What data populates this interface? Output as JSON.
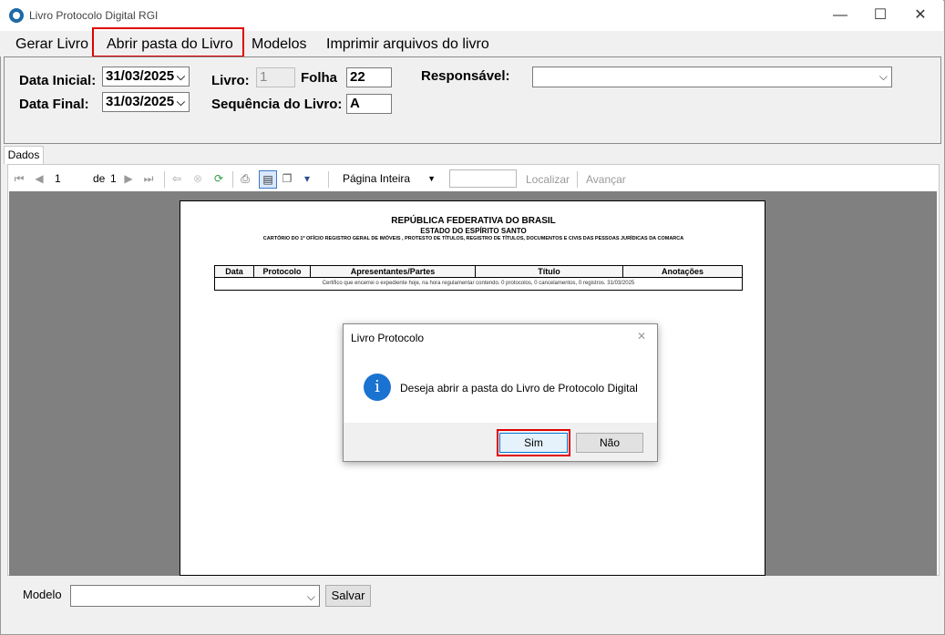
{
  "window": {
    "title": "Livro Protocolo Digital RGI",
    "minimize": "—",
    "maximize": "☐",
    "close": "✕"
  },
  "menu": {
    "items": [
      "Gerar Livro",
      "Abrir pasta do Livro",
      "Modelos",
      "Imprimir arquivos do livro"
    ]
  },
  "filters": {
    "data_inicial_label": "Data Inicial:",
    "data_inicial_value": "31/03/2025",
    "data_final_label": "Data Final:",
    "data_final_value": "31/03/2025",
    "livro_label": "Livro:",
    "livro_value": "1",
    "folha_label": "Folha",
    "folha_value": "22",
    "sequencia_label": "Sequência do Livro:",
    "sequencia_value": "A",
    "responsavel_label": "Responsável:",
    "responsavel_value": ""
  },
  "tabs": {
    "dados": "Dados"
  },
  "report_toolbar": {
    "page_value": "1",
    "of_label": "de",
    "total_pages": "1",
    "zoom_option": "Página Inteira",
    "search_value": "",
    "find_label": "Localizar",
    "next_label": "Avançar"
  },
  "report": {
    "title": "REPÚBLICA FEDERATIVA DO BRASIL",
    "state": "ESTADO DO ESPÍRITO SANTO",
    "office": "CARTÓRIO DO 1º OFÍCIO REGISTRO GERAL DE IMÓVEIS , PROTESTO DE TÍTULOS, REGISTRO DE TÍTULOS, DOCUMENTOS E CIVIS DAS PESSOAS JURÍDICAS DA COMARCA",
    "columns": [
      "Data",
      "Protocolo",
      "Apresentantes/Partes",
      "Título",
      "Anotações"
    ],
    "certification": "Certifico que encerrei o expediente hoje, na hora regulamentar contendo. 0 protocolos, 0 cancelamentos, 0 registros. 31/03/2025"
  },
  "dialog": {
    "title": "Livro Protocolo",
    "message": "Deseja abrir a pasta do Livro de Protocolo Digital",
    "yes_label": "Sim",
    "no_label": "Não",
    "close": "✕",
    "info_glyph": "i"
  },
  "bottom": {
    "modelo_label": "Modelo",
    "modelo_value": "",
    "save_label": "Salvar"
  },
  "colors": {
    "highlight": "#e00000",
    "info_icon": "#1a73d0",
    "report_bg": "#808080"
  }
}
